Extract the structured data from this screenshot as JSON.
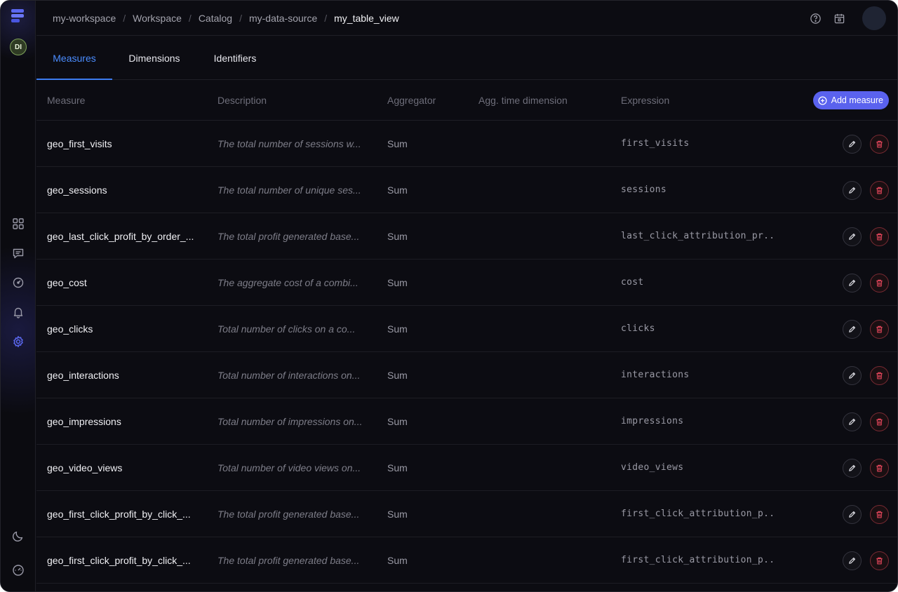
{
  "breadcrumb": [
    "my-workspace",
    "Workspace",
    "Catalog",
    "my-data-source",
    "my_table_view"
  ],
  "user": {
    "initials": "DI"
  },
  "tabs": [
    {
      "label": "Measures",
      "active": true
    },
    {
      "label": "Dimensions",
      "active": false
    },
    {
      "label": "Identifiers",
      "active": false
    }
  ],
  "columns": {
    "measure": "Measure",
    "description": "Description",
    "aggregator": "Aggregator",
    "time_dimension": "Agg. time dimension",
    "expression": "Expression"
  },
  "add_button": {
    "label": "Add measure"
  },
  "rows": [
    {
      "measure": "geo_first_visits",
      "description": "The total number of sessions w...",
      "aggregator": "Sum",
      "time_dimension": "",
      "expression": "first_visits"
    },
    {
      "measure": "geo_sessions",
      "description": "The total number of unique ses...",
      "aggregator": "Sum",
      "time_dimension": "",
      "expression": "sessions"
    },
    {
      "measure": "geo_last_click_profit_by_order_...",
      "description": "The total profit generated base...",
      "aggregator": "Sum",
      "time_dimension": "",
      "expression": "last_click_attribution_pr..."
    },
    {
      "measure": "geo_cost",
      "description": "The aggregate cost of a combi...",
      "aggregator": "Sum",
      "time_dimension": "",
      "expression": "cost"
    },
    {
      "measure": "geo_clicks",
      "description": "Total number of clicks on a co...",
      "aggregator": "Sum",
      "time_dimension": "",
      "expression": "clicks"
    },
    {
      "measure": "geo_interactions",
      "description": "Total number of interactions on...",
      "aggregator": "Sum",
      "time_dimension": "",
      "expression": "interactions"
    },
    {
      "measure": "geo_impressions",
      "description": "Total number of impressions on...",
      "aggregator": "Sum",
      "time_dimension": "",
      "expression": "impressions"
    },
    {
      "measure": "geo_video_views",
      "description": "Total number of video views on...",
      "aggregator": "Sum",
      "time_dimension": "",
      "expression": "video_views"
    },
    {
      "measure": "geo_first_click_profit_by_click_...",
      "description": "The total profit generated base...",
      "aggregator": "Sum",
      "time_dimension": "",
      "expression": "first_click_attribution_p..."
    },
    {
      "measure": "geo_first_click_profit_by_click_...",
      "description": "The total profit generated base...",
      "aggregator": "Sum",
      "time_dimension": "",
      "expression": "first_click_attribution_p..."
    }
  ],
  "colors": {
    "accent": "#5a62ee",
    "tab_active": "#4b8dff",
    "danger": "#e0455a",
    "background": "#0c0c12"
  },
  "icons": {
    "sidebar": [
      "logo-icon",
      "apps-grid-icon",
      "chat-icon",
      "gauge-icon",
      "bell-icon",
      "settings-icon",
      "moon-icon",
      "speedometer-icon"
    ],
    "topbar": [
      "help-icon",
      "calendar-icon"
    ],
    "row_actions": [
      "pencil-icon",
      "trash-icon"
    ]
  }
}
